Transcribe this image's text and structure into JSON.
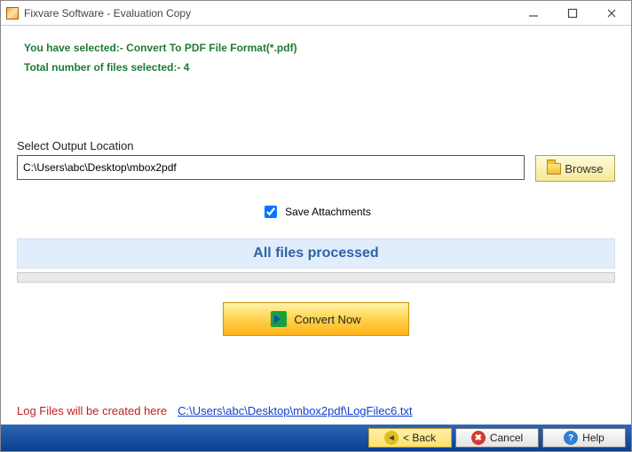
{
  "titlebar": {
    "title": "Fixvare Software - Evaluation Copy"
  },
  "info": {
    "selection_line": "You have selected:- Convert To PDF File Format(*.pdf)",
    "count_line": "Total number of files selected:- 4"
  },
  "output": {
    "label": "Select Output Location",
    "path": "C:\\Users\\abc\\Desktop\\mbox2pdf",
    "browse_label": "Browse"
  },
  "options": {
    "save_attachments_label": "Save Attachments",
    "save_attachments_checked": true
  },
  "status": {
    "message": "All files processed"
  },
  "convert": {
    "label": "Convert Now"
  },
  "log": {
    "label": "Log Files will be created here",
    "path": "C:\\Users\\abc\\Desktop\\mbox2pdf\\LogFilec6.txt"
  },
  "footer": {
    "back": "< Back",
    "cancel": "Cancel",
    "help": "Help"
  }
}
